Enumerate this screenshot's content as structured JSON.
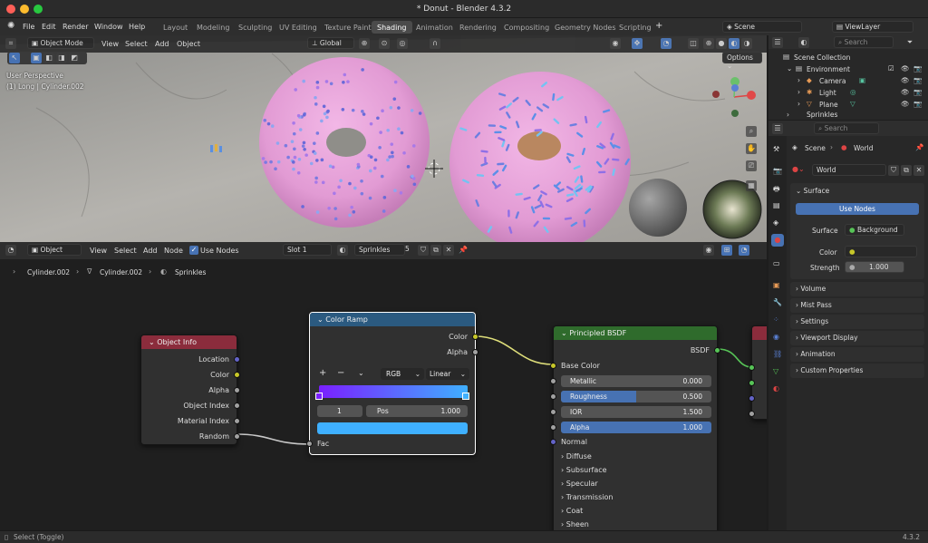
{
  "window": {
    "title": "* Donut - Blender 4.3.2"
  },
  "menu": [
    "File",
    "Edit",
    "Render",
    "Window",
    "Help"
  ],
  "workspaces": [
    "Layout",
    "Modeling",
    "Sculpting",
    "UV Editing",
    "Texture Paint",
    "Shading",
    "Animation",
    "Rendering",
    "Compositing",
    "Geometry Nodes",
    "Scripting"
  ],
  "active_workspace": "Shading",
  "scene": {
    "name": "Scene",
    "view_layer": "ViewLayer"
  },
  "viewport": {
    "mode": "Object Mode",
    "menus": [
      "View",
      "Select",
      "Add",
      "Object"
    ],
    "transform": "Global",
    "overlay1": "User Perspective",
    "overlay2": "(1) Long | Cylinder.002",
    "options": "Options"
  },
  "nodeeditor": {
    "type": "Object",
    "menus": [
      "View",
      "Select",
      "Add",
      "Node"
    ],
    "use_nodes": "Use Nodes",
    "slot": "Slot 1",
    "material": "Sprinkles",
    "users": "5",
    "breadcrumb": [
      "Cylinder.002",
      "Cylinder.002",
      "Sprinkles"
    ]
  },
  "object_info": {
    "title": "Object Info",
    "outputs": [
      "Location",
      "Color",
      "Alpha",
      "Object Index",
      "Material Index",
      "Random"
    ]
  },
  "color_ramp": {
    "title": "Color Ramp",
    "outputs": [
      "Color",
      "Alpha"
    ],
    "color_mode": "RGB",
    "interpolation": "Linear",
    "index": "1",
    "pos_label": "Pos",
    "pos_value": "1.000",
    "input": "Fac"
  },
  "bsdf": {
    "title": "Principled BSDF",
    "output": "BSDF",
    "base_color": "Base Color",
    "metallic_label": "Metallic",
    "metallic": "0.000",
    "roughness_label": "Roughness",
    "roughness": "0.500",
    "roughness_fill": 0.5,
    "ior_label": "IOR",
    "ior": "1.500",
    "alpha_label": "Alpha",
    "alpha": "1.000",
    "normal": "Normal",
    "subpanels": [
      "Diffuse",
      "Subsurface",
      "Specular",
      "Transmission",
      "Coat",
      "Sheen"
    ]
  },
  "outliner": {
    "search_placeholder": "Search",
    "items": [
      "Scene Collection",
      "Environment",
      "Camera",
      "Light",
      "Plane",
      "Sprinkles"
    ]
  },
  "properties": {
    "search_placeholder": "Search",
    "breadcrumb_scene": "Scene",
    "breadcrumb_world": "World",
    "world_name": "World",
    "surface_panel": "Surface",
    "use_nodes": "Use Nodes",
    "surface_label": "Surface",
    "surface_value": "Background",
    "color_label": "Color",
    "strength_label": "Strength",
    "strength": "1.000",
    "panels": [
      "Volume",
      "Mist Pass",
      "Settings",
      "Viewport Display",
      "Animation",
      "Custom Properties"
    ]
  },
  "status": {
    "left": "Select (Toggle)",
    "version": "4.3.2"
  },
  "colors": {
    "accent": "#4772b3",
    "bsdf_header": "#2f6b2c",
    "ramp_header": "#2b5a80",
    "info_header": "#8b2c3c",
    "socket_color": "#c7c729",
    "socket_vector": "#6363c7",
    "socket_float": "#a1a1a1"
  }
}
